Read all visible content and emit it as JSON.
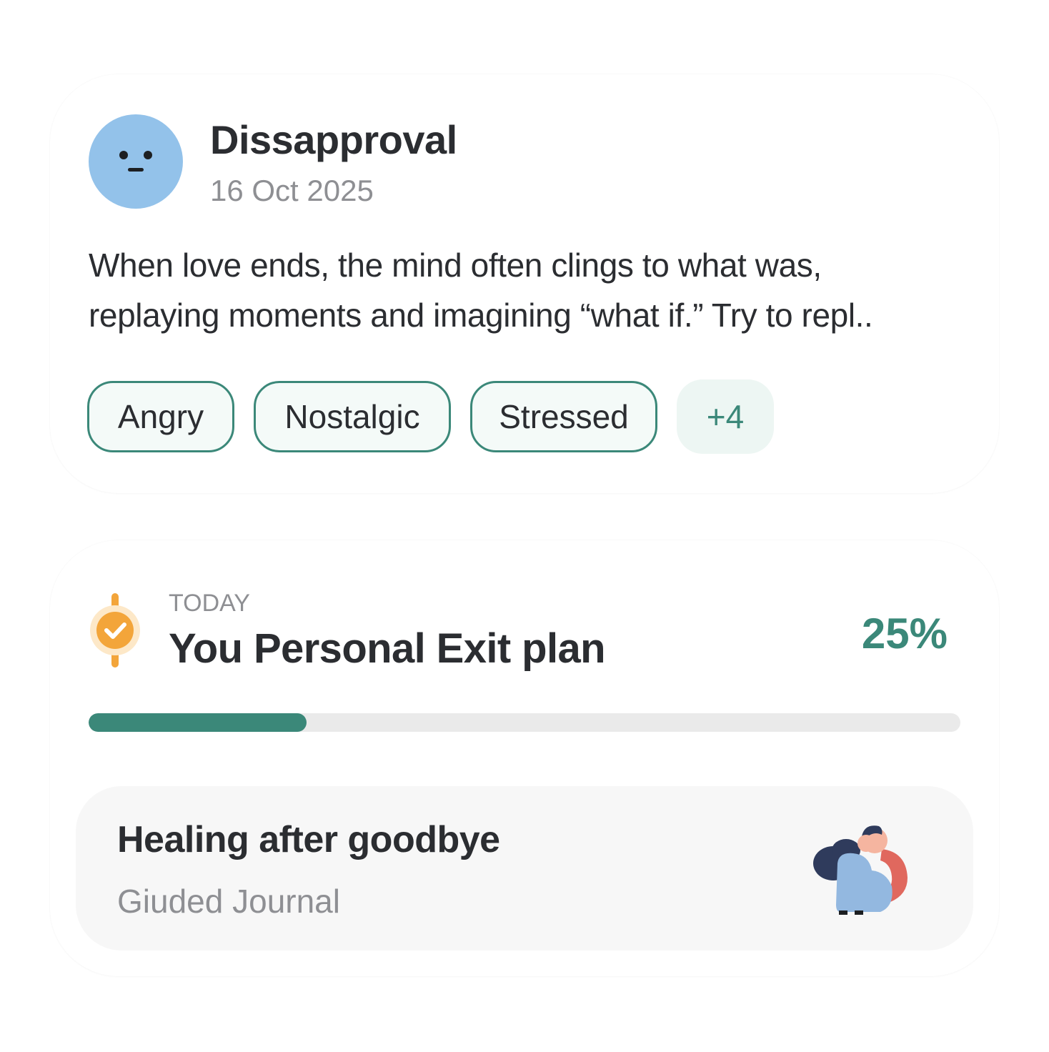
{
  "mood_entry": {
    "mood_icon": "neutral-face-icon",
    "mood_color": "#93c2ea",
    "title": "Dissapproval",
    "date": "16 Oct 2025",
    "body": "When love ends, the mind often clings to what was, replaying moments and imagining “what if.” Try to repl..",
    "tags": [
      "Angry",
      "Nostalgic",
      "Stressed"
    ],
    "more_tags": "+4",
    "accent_color": "#3b8879"
  },
  "exit_plan": {
    "icon": "milestone-check-icon",
    "icon_color": "#f3a53a",
    "overline": "TODAY",
    "title": "You Personal Exit plan",
    "percent_label": "25%",
    "progress": 0.25,
    "accent_color": "#3b8879",
    "journal": {
      "title": "Healing after goodbye",
      "subtitle": "Giuded Journal",
      "illustration": "embracing-couple-illustration"
    }
  }
}
